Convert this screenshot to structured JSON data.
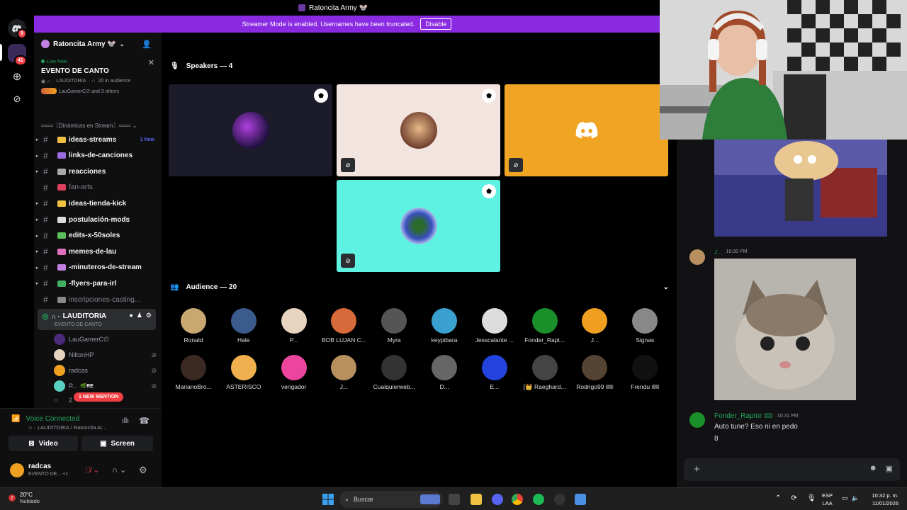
{
  "titlebar": {
    "text": "Ratoncita Army 🐭"
  },
  "banner": {
    "text": "Streamer Mode is enabled. Usernames have been truncated.",
    "button": "Disable"
  },
  "guilds": {
    "badge_top": "9",
    "badge_second": "41"
  },
  "server": {
    "name": "Ratoncita Army 🐭"
  },
  "live": {
    "status": "Live Now",
    "title": "EVENTO DE CANTO",
    "meta_channel": "LAUDITORIA",
    "meta_audience": "20 in audience",
    "hosts": "LauGamerC∅ and 3 others"
  },
  "sidebar": {
    "category": "═══〖Dinámicas en Stream〗═══",
    "channels": [
      {
        "name": "ideas-streams",
        "badge": "1 New",
        "dim": false
      },
      {
        "name": "links-de-canciones",
        "badge": "",
        "dim": false
      },
      {
        "name": "reacciones",
        "badge": "",
        "dim": false
      },
      {
        "name": "fan-arts",
        "badge": "",
        "dim": true
      },
      {
        "name": "ideas-tienda-kick",
        "badge": "",
        "dim": false
      },
      {
        "name": "postulación-mods",
        "badge": "",
        "dim": false
      },
      {
        "name": "edits-x-50soles",
        "badge": "",
        "dim": false
      },
      {
        "name": "memes-de-lau",
        "badge": "",
        "dim": false
      },
      {
        "name": "-minuteros-de-stream",
        "badge": "",
        "dim": false
      },
      {
        "name": "-flyers-para-irl",
        "badge": "",
        "dim": false
      },
      {
        "name": "inscripciones-casting...",
        "badge": "",
        "dim": true
      }
    ],
    "stage_channel": {
      "name": "LAUDITORIA",
      "event": "EVENTO DE CANTO"
    },
    "users": [
      {
        "name": "LauGamerC∅"
      },
      {
        "name": "NiltonHP"
      },
      {
        "name": "radcas"
      },
      {
        "name": "P...",
        "tag": "RE"
      },
      {
        "name": "2"
      }
    ],
    "mention": "1 NEW MENTION"
  },
  "voice": {
    "status": "Voice Connected",
    "location": "LAUDITORIA / Ratoncita Ar...",
    "video": "Video",
    "screen": "Screen",
    "user": "radcas",
    "user_status": "EVENTO DE... +1"
  },
  "stage": {
    "speakers_title": "Speakers — 4",
    "audience_title": "Audience — 20",
    "audience": [
      {
        "name": "Ronald",
        "color": "#c8a870"
      },
      {
        "name": "Hale",
        "color": "#3b5b8c"
      },
      {
        "name": "P...",
        "color": "#e6d4c0"
      },
      {
        "name": "BOB LUJAN C...",
        "color": "#d66a3a"
      },
      {
        "name": "Myra",
        "color": "#555"
      },
      {
        "name": "keypibara",
        "color": "#3aa0d0"
      },
      {
        "name": "Jesscalante ...",
        "color": "#ddd"
      },
      {
        "name": "Fonder_Rapt...",
        "color": "#1a8f2a"
      },
      {
        "name": "J...",
        "color": "#f0a020"
      },
      {
        "name": "Signas",
        "color": "#888"
      },
      {
        "name": "MarianoBro...",
        "color": "#3a2a22"
      },
      {
        "name": "ASTERISCO",
        "color": "#f0b050"
      },
      {
        "name": "vengador",
        "color": "#eb459e"
      },
      {
        "name": "J...",
        "color": "#b89060"
      },
      {
        "name": "Cualquierweb...",
        "color": "#333"
      },
      {
        "name": "D...",
        "color": "#666"
      },
      {
        "name": "E...",
        "color": "#2244dd"
      },
      {
        "name": "[👑 Raeghard...",
        "color": "#444"
      },
      {
        "name": "Rodrigo99 🎟",
        "color": "#554433"
      },
      {
        "name": "Frendu 🎟",
        "color": "#111"
      }
    ]
  },
  "chat": {
    "msg1_user": "J...",
    "msg1_time": "10:30 PM",
    "msg2_user": "Fonder_Raptor 🎟",
    "msg2_time": "10:31 PM",
    "msg2_text": "Auto tune? Eso ni en pedo",
    "msg3_text": "8"
  },
  "taskbar": {
    "temp": "20°C",
    "weather": "Nublado",
    "weather_badge": "2",
    "search": "Buscar",
    "lang1": "ESP",
    "lang2": "LAA",
    "time": "10:32 p. m.",
    "date": "11/01/2026"
  }
}
